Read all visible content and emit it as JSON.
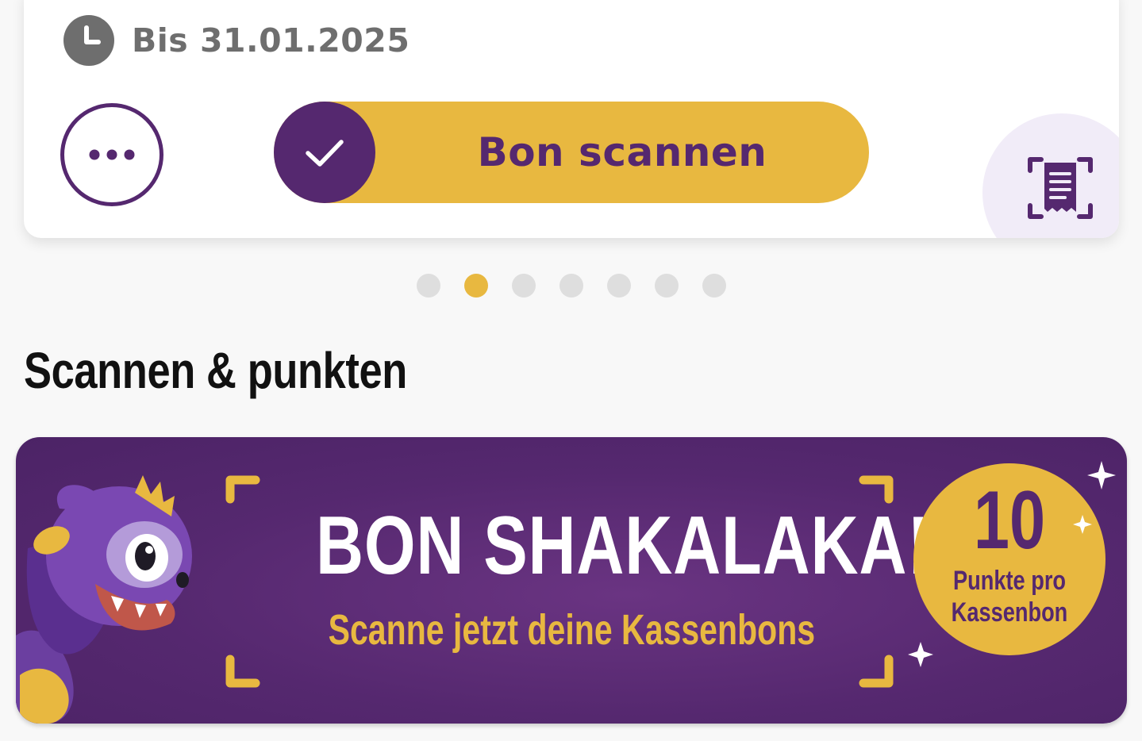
{
  "offer_card": {
    "valid_until": "Bis 31.01.2025",
    "scan_button_label": "Bon scannen",
    "clock_icon": "clock-icon",
    "more_icon": "more-horizontal-icon",
    "check_icon": "checkmark-icon",
    "receipt_scan_icon": "receipt-scan-icon"
  },
  "pagination": {
    "total": 7,
    "active_index": 1
  },
  "section": {
    "title": "Scannen & punkten"
  },
  "banner": {
    "title": "BON SHAKALAKA!",
    "subtitle": "Scanne jetzt deine Kassenbons",
    "points_value": "10",
    "points_line1": "Punkte pro",
    "points_line2": "Kassenbon"
  },
  "colors": {
    "brand_purple": "#55286f",
    "brand_yellow": "#e8b840",
    "muted_gray": "#6e6e6e",
    "background": "#f8f8f8"
  }
}
